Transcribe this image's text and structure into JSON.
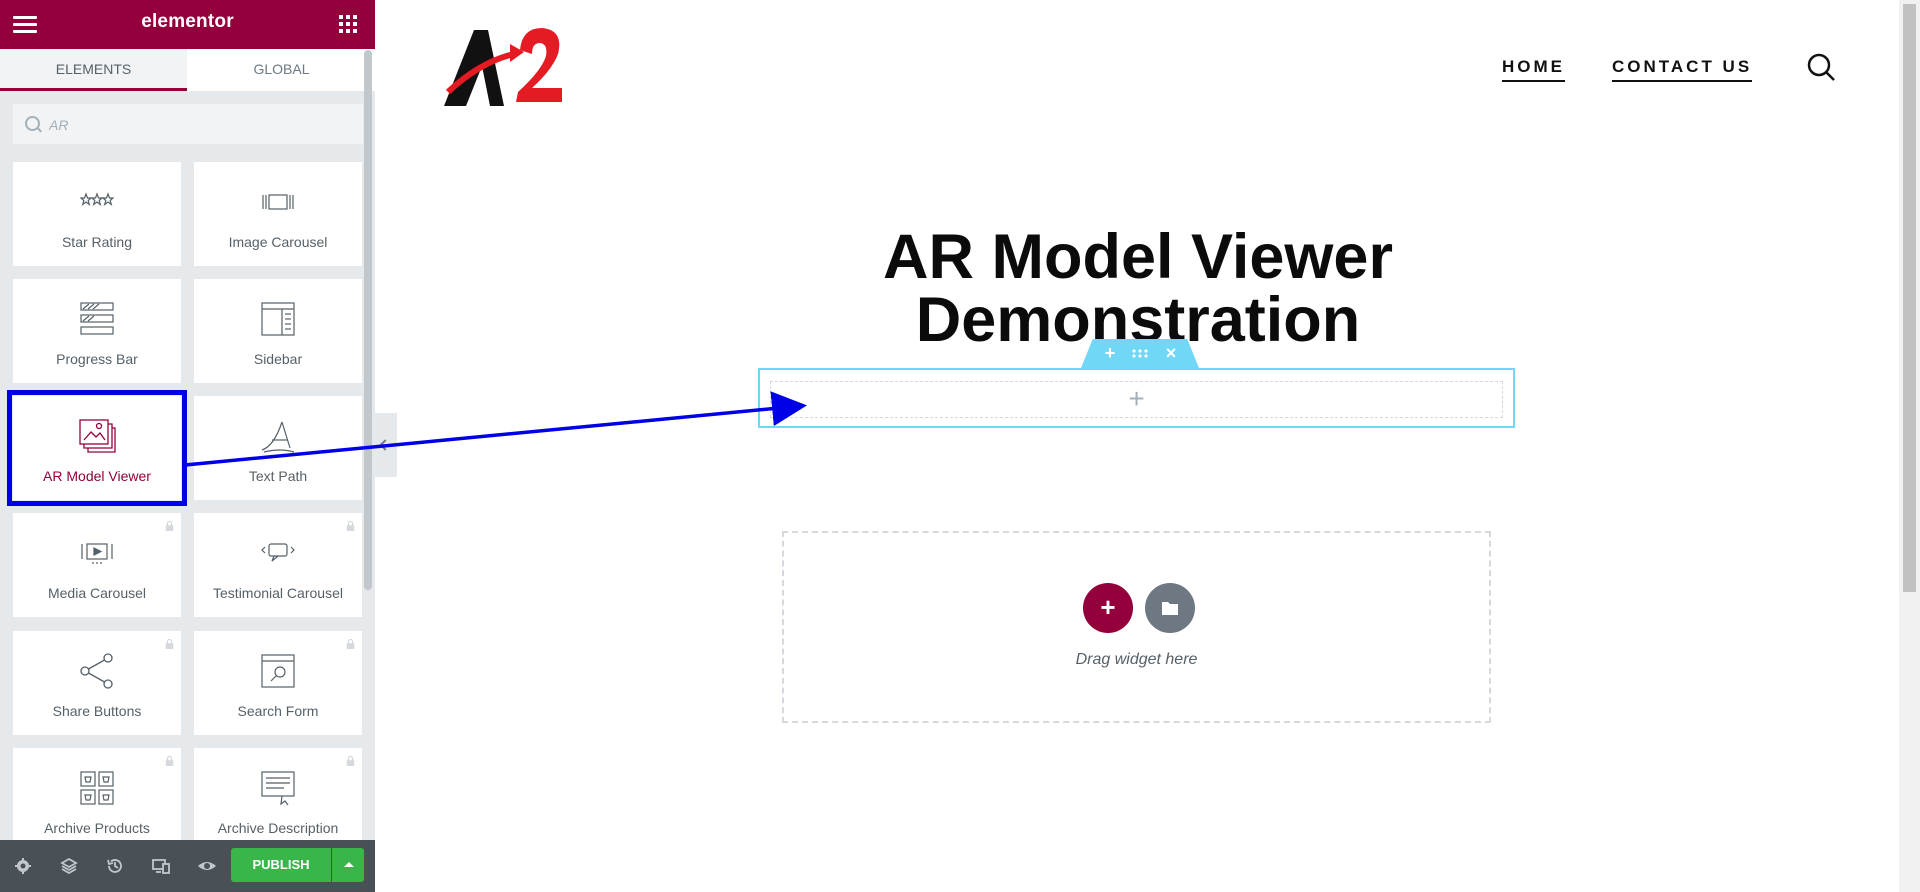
{
  "panel": {
    "brand": "elementor",
    "tabs": [
      {
        "label": "ELEMENTS",
        "active": true
      },
      {
        "label": "GLOBAL",
        "active": false
      }
    ],
    "search": {
      "placeholder": "AR",
      "value": ""
    },
    "widgets": [
      {
        "label": "Star Rating",
        "icon": "star-rating-icon",
        "locked": false,
        "selected": false
      },
      {
        "label": "Image Carousel",
        "icon": "image-carousel-icon",
        "locked": false,
        "selected": false
      },
      {
        "label": "Progress Bar",
        "icon": "progress-bar-icon",
        "locked": false,
        "selected": false
      },
      {
        "label": "Sidebar",
        "icon": "sidebar-icon",
        "locked": false,
        "selected": false
      },
      {
        "label": "AR Model Viewer",
        "icon": "gallery-icon",
        "locked": false,
        "selected": true
      },
      {
        "label": "Text Path",
        "icon": "text-path-icon",
        "locked": false,
        "selected": false
      },
      {
        "label": "Media Carousel",
        "icon": "media-carousel-icon",
        "locked": true,
        "selected": false
      },
      {
        "label": "Testimonial Carousel",
        "icon": "testimonial-carousel-icon",
        "locked": true,
        "selected": false
      },
      {
        "label": "Share Buttons",
        "icon": "share-icon",
        "locked": true,
        "selected": false
      },
      {
        "label": "Search Form",
        "icon": "search-form-icon",
        "locked": true,
        "selected": false
      },
      {
        "label": "Archive Products",
        "icon": "archive-products-icon",
        "locked": true,
        "selected": false
      },
      {
        "label": "Archive Description",
        "icon": "archive-description-icon",
        "locked": true,
        "selected": false
      }
    ],
    "footer": {
      "icons": [
        "settings-icon",
        "navigator-icon",
        "history-icon",
        "responsive-icon",
        "preview-icon"
      ],
      "publish_label": "PUBLISH"
    }
  },
  "site": {
    "nav": [
      {
        "label": "HOME"
      },
      {
        "label": "CONTACT US"
      }
    ],
    "page_title_line1": "AR Model Viewer",
    "page_title_line2": "Demonstration",
    "drop_text": "Drag widget here"
  },
  "colors": {
    "brand": "#93003c",
    "publish": "#39b54a",
    "section_outline": "#71d7f7",
    "annotation": "#0000e6"
  }
}
